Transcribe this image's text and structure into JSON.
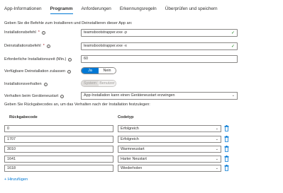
{
  "tabs": [
    {
      "label": "App-Informationen",
      "active": false
    },
    {
      "label": "Programm",
      "active": true
    },
    {
      "label": "Anforderungen",
      "active": false
    },
    {
      "label": "Erkennungsregeln",
      "active": false
    },
    {
      "label": "Überprüfen und speichern",
      "active": false
    }
  ],
  "intro": "Geben Sie die Befehle zum Installieren und Deinstallieren dieser App an:",
  "install": {
    "label": "Installationsbefehl",
    "required": "*",
    "value": "teamsbootstrapper.exe -p"
  },
  "uninstall": {
    "label": "Deinstallationsbefehl",
    "required": "*",
    "value": "teamsbootstrapper.exe -x"
  },
  "install_time": {
    "label": "Erforderliche Installationszeit (Min.)",
    "value": "60"
  },
  "allow_uninstall": {
    "label": "Verfügbare Deinstallation zulassen",
    "yes": "Ja",
    "no": "Nein",
    "selected": "Ja"
  },
  "install_behavior": {
    "label": "Installationsverhalten",
    "system": "System",
    "user": "Benutzer",
    "selected": "System"
  },
  "restart_behavior": {
    "label": "Verhalten beim Geräteneustart",
    "value": "App-Installation kann einen Geräteneustart erzwingen"
  },
  "return_codes": {
    "intro": "Geben Sie Rückgabecodes an, um das Verhalten nach der Installation festzulegen:",
    "code_header": "Rückgabecode",
    "type_header": "Codetyp",
    "rows": [
      {
        "code": "0",
        "type": "Erfolgreich"
      },
      {
        "code": "1707",
        "type": "Erfolgreich"
      },
      {
        "code": "3010",
        "type": "Warmneustart"
      },
      {
        "code": "1641",
        "type": "Harter Neustart"
      },
      {
        "code": "1618",
        "type": "Wiederholen"
      }
    ]
  },
  "add_link": "+ Hinzufügen",
  "icons": {
    "info": "info-icon",
    "check": "checkmark-icon",
    "chevron": "chevron-down-icon",
    "trash": "trash-icon"
  },
  "colors": {
    "accent": "#0078d4",
    "success": "#107c10",
    "required": "#a4262c"
  }
}
